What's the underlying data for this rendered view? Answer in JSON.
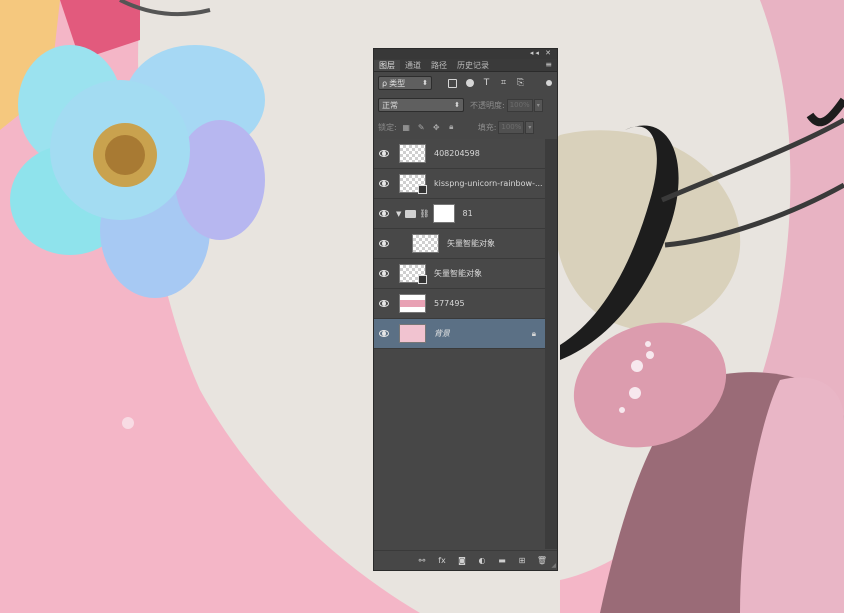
{
  "panel": {
    "tabs": [
      {
        "label": "图层"
      },
      {
        "label": "通道"
      },
      {
        "label": "路径"
      },
      {
        "label": "历史记录"
      }
    ],
    "window_controls": "◂◂ ✕",
    "menu_icon": "hamburger-menu-icon",
    "filter": {
      "prefix": "ρ",
      "label": "类型",
      "icons": [
        "image-filter-icon",
        "adjustment-filter-icon",
        "type-filter-icon",
        "shape-filter-icon",
        "smart-object-filter-icon"
      ]
    },
    "blend": {
      "mode": "正常",
      "opacity_label": "不透明度:",
      "opacity_value": "100%"
    },
    "lock": {
      "label": "锁定:",
      "fill_label": "填充:",
      "fill_value": "100%"
    },
    "layers": [
      {
        "name": "408204598",
        "thumb": "transparent",
        "visible": true
      },
      {
        "name": "kisspng-unicorn-rainbow-...",
        "thumb": "transparent-smart",
        "visible": true
      },
      {
        "name": "81",
        "thumb": "group-mask",
        "visible": true,
        "group": true
      },
      {
        "name": "矢量智能对象",
        "thumb": "transparent",
        "visible": true,
        "indent": true
      },
      {
        "name": "矢量智能对象",
        "thumb": "transparent-smart",
        "visible": true
      },
      {
        "name": "577495",
        "thumb": "pink-strip",
        "visible": true
      },
      {
        "name": "背景",
        "thumb": "pink",
        "visible": true,
        "selected": true,
        "locked": true
      }
    ],
    "bottom_icons": [
      "link-layers-icon",
      "fx-icon",
      "add-mask-icon",
      "adjustment-layer-icon",
      "new-group-icon",
      "new-layer-icon",
      "delete-icon"
    ],
    "bottom_glyphs": [
      "⚯",
      "fx",
      "◙",
      "◐",
      "▬",
      "⊞",
      "🗑"
    ],
    "colors": {
      "panel_bg": "#474747",
      "selected": "#5b7085",
      "canvas_pink": "#f3b9c8",
      "cream": "#e6e2dc"
    }
  }
}
